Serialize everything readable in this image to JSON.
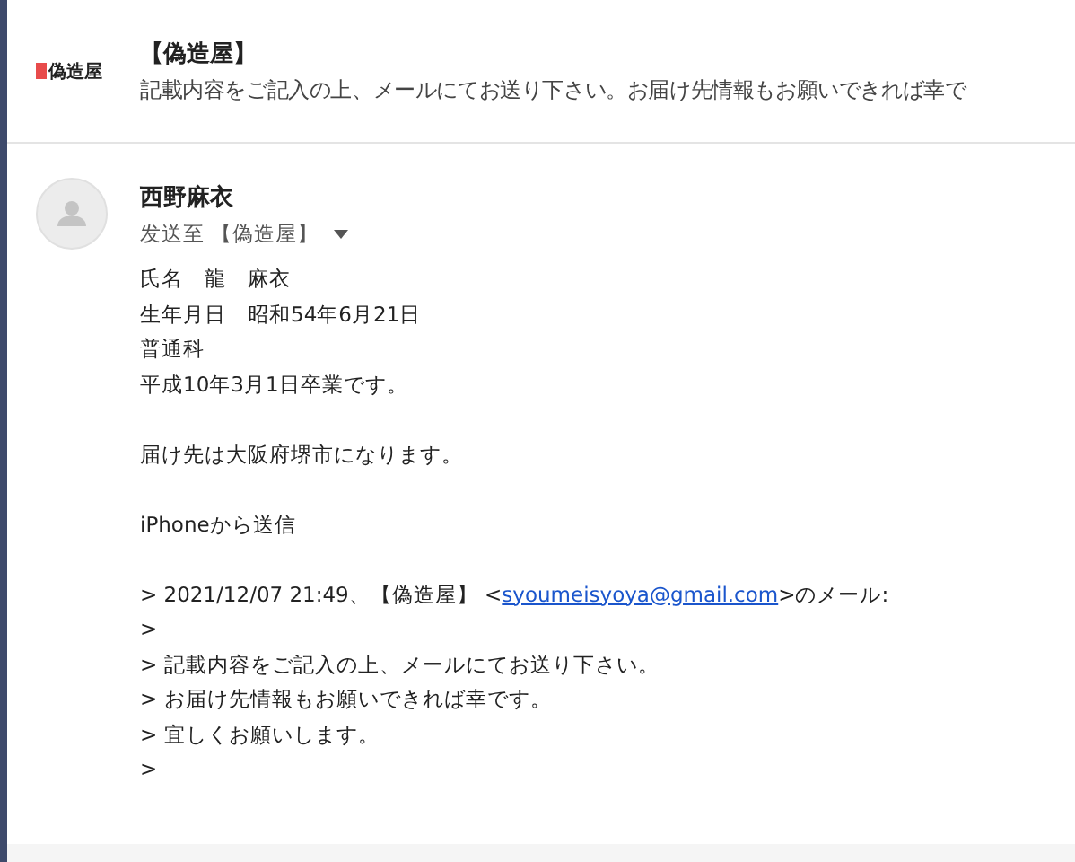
{
  "header": {
    "logo": "偽造屋",
    "title": "【偽造屋】",
    "snippet": "記載内容をご記入の上、メールにてお送り下さい。お届け先情報もお願いできれば幸で"
  },
  "message": {
    "sender": "西野麻衣",
    "recipient": "发送至 【偽造屋】",
    "paragraphs": [
      [
        "氏名　龍　麻衣",
        "生年月日　昭和54年6月21日",
        "普通科",
        "平成10年3月1日卒業です。"
      ],
      [
        "届け先は大阪府堺市になります。"
      ],
      [
        "iPhoneから送信"
      ],
      [
        {
          "text": "> 2021/12/07 21:49、【偽造屋】 <",
          "link": "syoumeisyoya@gmail.com",
          "after": ">のメール:"
        },
        ">",
        "> 記載内容をご記入の上、メールにてお送り下さい。",
        "> お届け先情報もお願いできれば幸です。",
        "> 宜しくお願いします。",
        ">"
      ]
    ]
  }
}
